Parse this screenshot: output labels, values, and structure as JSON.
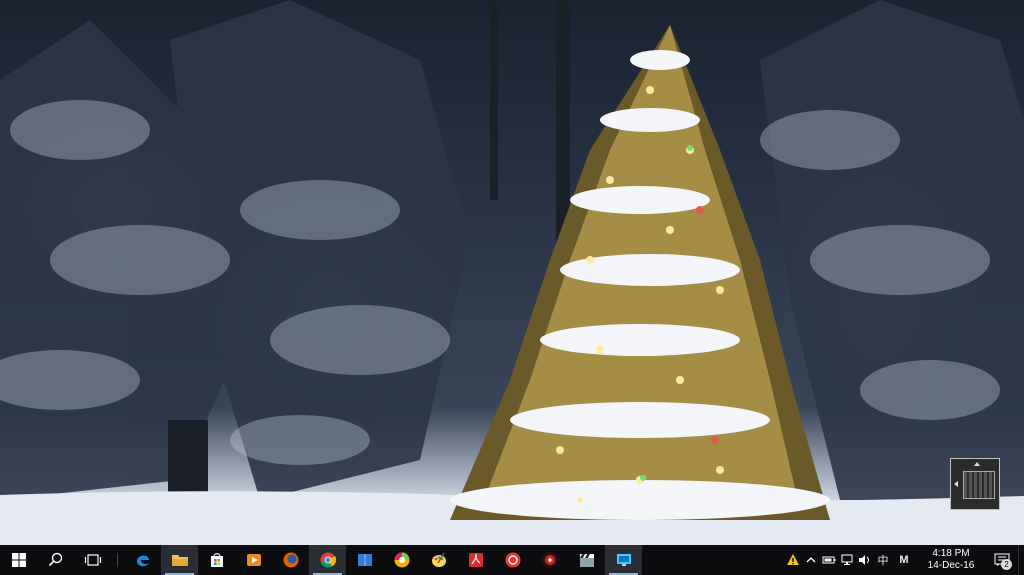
{
  "desktop": {
    "wallpaper": "snowy-forest-christmas-tree"
  },
  "taskbar": {
    "start": {
      "icon": "windows-logo-icon"
    },
    "search": {
      "icon": "search-icon"
    },
    "task_view": {
      "icon": "task-view-icon"
    },
    "pinned": [
      {
        "name": "edge",
        "icon": "edge-icon",
        "color": "#1e88e5",
        "active": false
      },
      {
        "name": "file-explorer",
        "icon": "folder-icon",
        "color": "#f2c14e",
        "active": true
      },
      {
        "name": "store",
        "icon": "store-icon",
        "color": "#ffffff",
        "active": false
      },
      {
        "name": "media-player",
        "icon": "media-player-icon",
        "color": "#f08a24",
        "active": false
      },
      {
        "name": "firefox",
        "icon": "firefox-icon",
        "color": "#e66000",
        "active": false
      },
      {
        "name": "chrome",
        "icon": "chrome-icon",
        "color": "#4caf50",
        "active": true
      },
      {
        "name": "book-app",
        "icon": "book-icon",
        "color": "#3a7bd5",
        "active": false
      },
      {
        "name": "color-app",
        "icon": "color-wheel-icon",
        "color": "#f5b300",
        "active": false
      },
      {
        "name": "paint-app",
        "icon": "paint-palette-icon",
        "color": "#ffd54f",
        "active": false
      },
      {
        "name": "acrobat",
        "icon": "pdf-icon",
        "color": "#d32f2f",
        "active": false
      },
      {
        "name": "red-app",
        "icon": "red-circle-app-icon",
        "color": "#e53935",
        "active": false
      },
      {
        "name": "recorder",
        "icon": "record-icon",
        "color": "#c62828",
        "active": false
      },
      {
        "name": "video-editor",
        "icon": "clapperboard-icon",
        "color": "#90a4ae",
        "active": false
      },
      {
        "name": "remote-app",
        "icon": "monitor-icon",
        "color": "#4fc3f7",
        "active": true
      }
    ]
  },
  "tray": {
    "warning_icon": "warning-icon",
    "chevron_icon": "chevron-up-icon",
    "battery_icon": "battery-icon",
    "network_icon": "network-icon",
    "volume_icon": "volume-icon",
    "ime_label": "中",
    "input_label": "M",
    "clock_time": "4:18 PM",
    "clock_date": "14-Dec-16",
    "notification_count": "2"
  }
}
